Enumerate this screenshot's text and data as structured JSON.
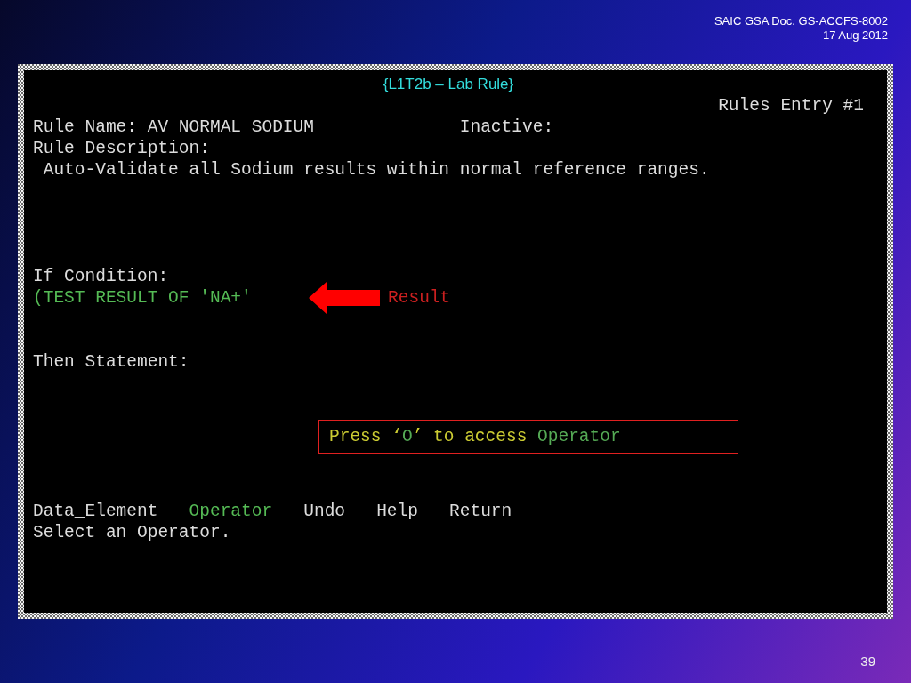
{
  "header": {
    "doc_ref": "SAIC GSA Doc. GS-ACCFS-8002",
    "date": "17 Aug 2012"
  },
  "terminal": {
    "title": "{L1T2b – Lab Rule}",
    "screen_label": "Rules Entry #1",
    "rule_name": "Rule Name: AV NORMAL SODIUM",
    "inactive_label": "Inactive:",
    "description_label": "Rule Description:",
    "description": "Auto-Validate all Sodium results within normal reference ranges.",
    "if_label": "If Condition:",
    "condition": "(TEST RESULT OF 'NA+'",
    "then_label": "Then Statement:",
    "menu": [
      {
        "label": "Data_Element",
        "selected": false
      },
      {
        "label": "Operator",
        "selected": true
      },
      {
        "label": "Undo",
        "selected": false
      },
      {
        "label": "Help",
        "selected": false
      },
      {
        "label": "Return",
        "selected": false
      }
    ],
    "prompt": "Select an Operator."
  },
  "annotations": {
    "arrow_label": "Result",
    "callout": [
      {
        "text": "Press ‘",
        "color": "#cccc33"
      },
      {
        "text": "O",
        "color": "#55aa55"
      },
      {
        "text": "’ to access ",
        "color": "#cccc33"
      },
      {
        "text": "Operator",
        "color": "#55aa55"
      }
    ]
  },
  "page_number": "39"
}
